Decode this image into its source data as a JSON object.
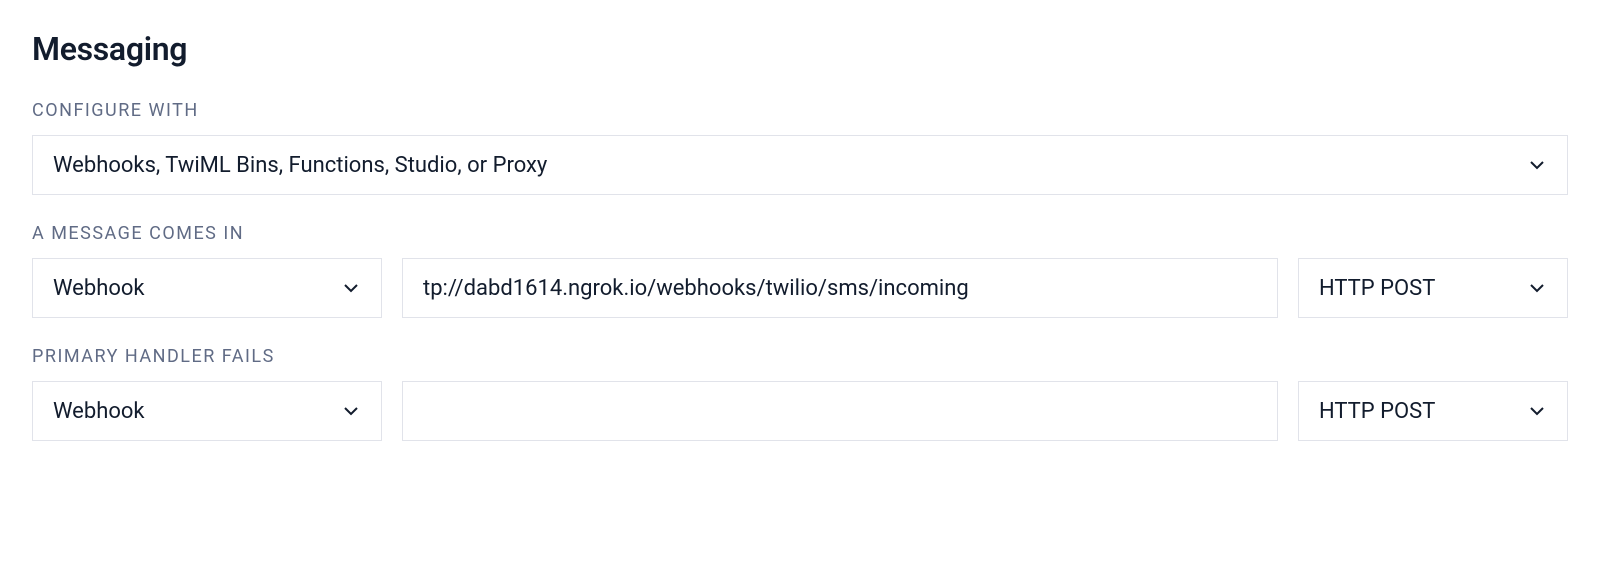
{
  "section": {
    "title": "Messaging"
  },
  "configure_with": {
    "label": "CONFIGURE WITH",
    "selected": "Webhooks, TwiML Bins, Functions, Studio, or Proxy"
  },
  "message_comes_in": {
    "label": "A MESSAGE COMES IN",
    "type_selected": "Webhook",
    "url_value": "tp://dabd1614.ngrok.io/webhooks/twilio/sms/incoming",
    "method_selected": "HTTP POST"
  },
  "primary_handler_fails": {
    "label": "PRIMARY HANDLER FAILS",
    "type_selected": "Webhook",
    "url_value": "",
    "method_selected": "HTTP POST"
  }
}
